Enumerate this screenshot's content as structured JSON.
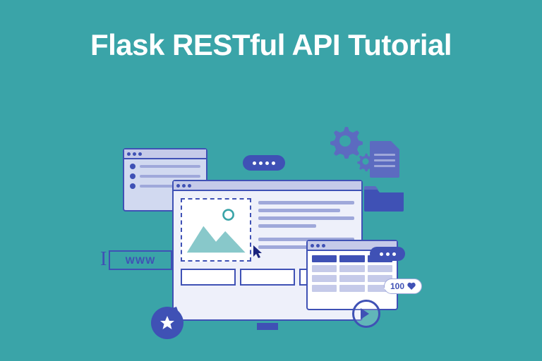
{
  "title": "Flask RESTful API Tutorial",
  "www_label": "WWW",
  "like_count": "100"
}
